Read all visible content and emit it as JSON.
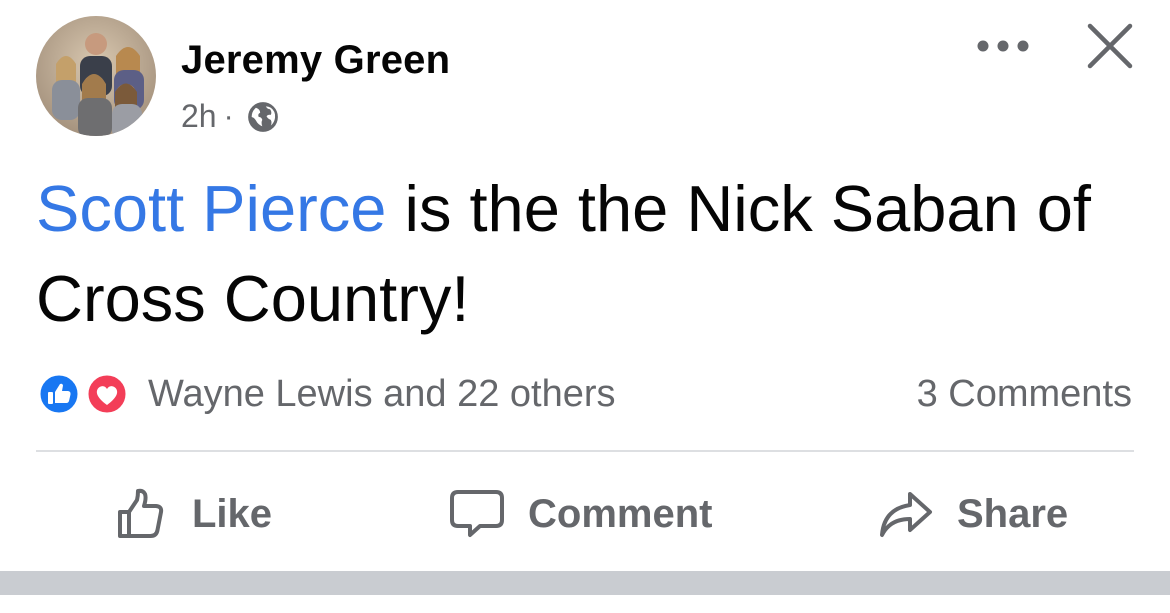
{
  "post": {
    "author_name": "Jeremy Green",
    "timestamp": "2h",
    "separator": "·",
    "privacy_icon": "globe-icon",
    "body_mention": "Scott Pierce",
    "body_text": " is the the Nick Saban of Cross Country!"
  },
  "reactions": {
    "icons": [
      "like-reaction-icon",
      "love-reaction-icon"
    ],
    "summary": "Wayne Lewis and 22 others",
    "comments": "3 Comments"
  },
  "actions": {
    "like_label": "Like",
    "comment_label": "Comment",
    "share_label": "Share"
  },
  "colors": {
    "mention": "#3578e5",
    "like_blue": "#1877f2",
    "love_red": "#f33e58",
    "secondary_text": "#65676b"
  }
}
